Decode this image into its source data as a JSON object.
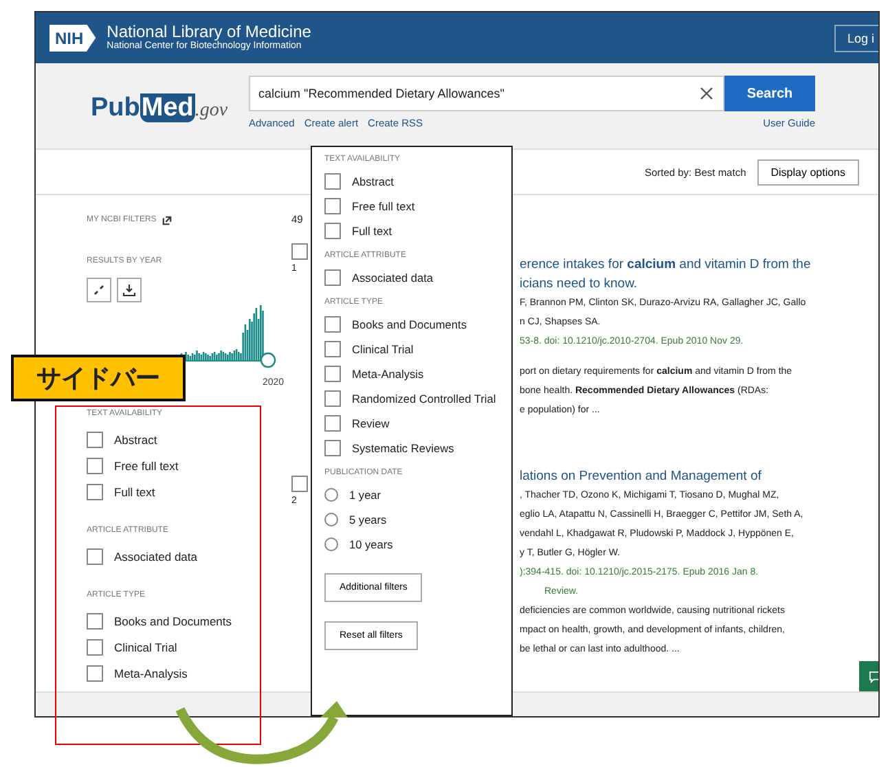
{
  "header": {
    "logo": "NIH",
    "title": "National Library of Medicine",
    "subtitle": "National Center for Biotechnology Information",
    "login_button": "Log i"
  },
  "search": {
    "logo": {
      "part1": "Pub",
      "part2": "Med",
      "suffix": ".gov"
    },
    "query": "calcium \"Recommended Dietary Allowances\"",
    "button": "Search",
    "links": [
      "Advanced",
      "Create alert",
      "Create RSS"
    ],
    "help_link": "User Guide"
  },
  "toolbar": {
    "sort_label": "Sorted by: Best match",
    "display_button": "Display options"
  },
  "sidebar": {
    "my_filters": "MY NCBI FILTERS",
    "results_by_year": "RESULTS BY YEAR",
    "year_label": "2020",
    "sections": [
      {
        "heading": "TEXT AVAILABILITY",
        "items": [
          {
            "label": "Abstract",
            "checked": false
          },
          {
            "label": "Free full text",
            "checked": false
          },
          {
            "label": "Full text",
            "checked": false
          }
        ]
      },
      {
        "heading": "ARTICLE ATTRIBUTE",
        "items": [
          {
            "label": "Associated data",
            "checked": false
          }
        ]
      },
      {
        "heading": "ARTICLE TYPE",
        "items": [
          {
            "label": "Books and Documents",
            "checked": false
          },
          {
            "label": "Clinical Trial",
            "checked": false
          },
          {
            "label": "Meta-Analysis",
            "checked": false
          }
        ]
      }
    ]
  },
  "results": {
    "count": "49",
    "items": [
      {
        "number": "1",
        "selected": false,
        "title_lines": [
          "erence intakes for **calcium** and vitamin D from the",
          "icians need to know."
        ],
        "author_lines": [
          "F, Brannon PM, Clinton SK, Durazo-Arvizu RA, Gallagher JC, Gallo",
          "n CJ, Shapses SA."
        ],
        "citation": "53-8. doi: 10.1210/jc.2010-2704. Epub 2010 Nov 29.",
        "snippet_lines": [
          "port on dietary requirements for **calcium** and vitamin D from the",
          "bone health. **Recommended Dietary Allowances** (RDAs:",
          "e population) for ..."
        ]
      },
      {
        "number": "2",
        "selected": false,
        "title_lines": [
          "lations on Prevention and Management of"
        ],
        "author_lines": [
          ", Thacher TD, Ozono K, Michigami T, Tiosano D, Mughal MZ,",
          "eglio LA, Atapattu N, Cassinelli H, Braegger C, Pettifor JM, Seth A,",
          "vendahl L, Khadgawat R, Pludowski P, Maddock J, Hyppönen E,",
          "y T, Butler G, Högler W."
        ],
        "citation": "):394-415. doi: 10.1210/jc.2015-2175. Epub 2016 Jan 8.",
        "tag": "Review.",
        "snippet_lines": [
          "deficiencies are common worldwide, causing nutritional rickets",
          "mpact on health, growth, and development of infants, children,",
          "be lethal or can last into adulthood. ..."
        ]
      }
    ]
  },
  "filter_popup": {
    "sections": [
      {
        "heading": "TEXT AVAILABILITY",
        "items": [
          {
            "label": "Abstract",
            "checked": false
          },
          {
            "label": "Free full text",
            "checked": false
          },
          {
            "label": "Full text",
            "checked": false
          }
        ]
      },
      {
        "heading": "ARTICLE ATTRIBUTE",
        "items": [
          {
            "label": "Associated data",
            "checked": false
          }
        ]
      },
      {
        "heading": "ARTICLE TYPE",
        "items": [
          {
            "label": "Books and Documents",
            "checked": false
          },
          {
            "label": "Clinical Trial",
            "checked": false
          },
          {
            "label": "Meta-Analysis",
            "checked": false
          },
          {
            "label": "Randomized Controlled Trial",
            "checked": false
          },
          {
            "label": "Review",
            "checked": false
          },
          {
            "label": "Systematic Reviews",
            "checked": false
          }
        ]
      }
    ],
    "date_section": {
      "heading": "PUBLICATION DATE",
      "options": [
        {
          "label": "1 year",
          "selected": false
        },
        {
          "label": "5 years",
          "selected": false
        },
        {
          "label": "10 years",
          "selected": false
        }
      ]
    },
    "buttons": [
      "Additional filters",
      "Reset all filters"
    ]
  },
  "annotation": {
    "label": "サイドバー"
  }
}
